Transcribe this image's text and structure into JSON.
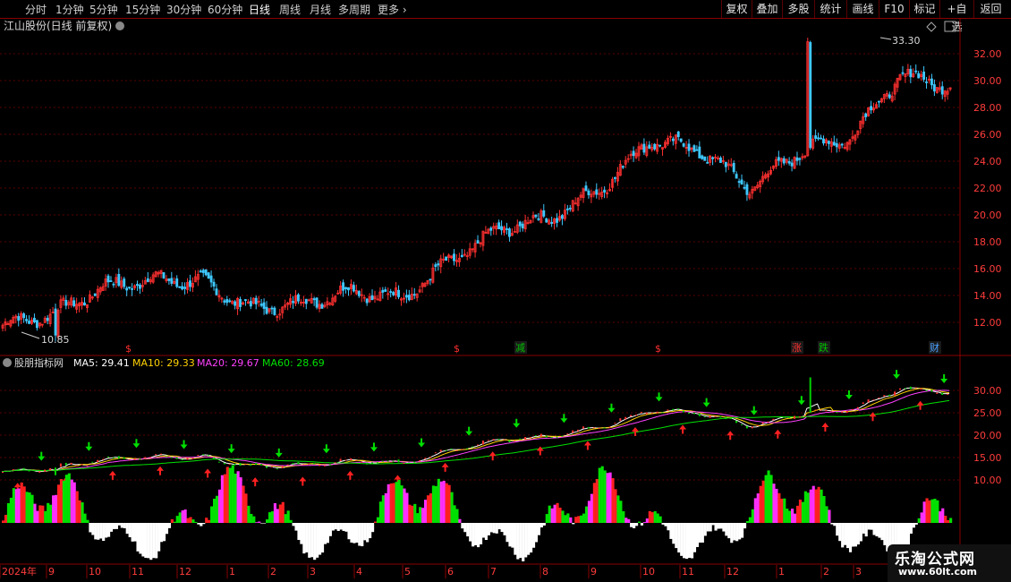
{
  "toolbar": {
    "periods": [
      "分时",
      "1分钟",
      "5分钟",
      "15分钟",
      "30分钟",
      "60分钟",
      "日线",
      "周线",
      "月线",
      "多周期",
      "更多"
    ],
    "active_period": "日线",
    "buttons": [
      "复权",
      "叠加",
      "多股",
      "统计",
      "画线",
      "F10",
      "标记",
      "+自选",
      "返回"
    ]
  },
  "main_panel": {
    "title": "江山股份(日线 前复权)",
    "high_marker": "33.30",
    "low_marker": "10.85",
    "price_axis": [
      "32.00",
      "30.00",
      "28.00",
      "26.00",
      "24.00",
      "22.00",
      "20.00",
      "18.00",
      "16.00",
      "14.00",
      "12.00"
    ],
    "event_marks": [
      {
        "text": "$",
        "color": "#ff3030"
      },
      {
        "text": "$",
        "color": "#ff3030"
      },
      {
        "text": "减",
        "color": "#00c000"
      },
      {
        "text": "$",
        "color": "#ff3030"
      },
      {
        "text": "涨",
        "color": "#ff3030"
      },
      {
        "text": "跌",
        "color": "#00c000"
      },
      {
        "text": "财",
        "color": "#4aa0ff"
      }
    ]
  },
  "indicator_panel": {
    "name": "股朋指标网",
    "ma5_label": "MA5: 29.41",
    "ma10_label": "MA10: 29.33",
    "ma20_label": "MA20: 29.67",
    "ma60_label": "MA60: 28.69",
    "colors": {
      "ma5": "#ffffff",
      "ma10": "#ffd200",
      "ma20": "#ff40ff",
      "ma60": "#00e000"
    },
    "price_axis": [
      "30.00",
      "25.00",
      "20.00",
      "15.00",
      "10.00"
    ]
  },
  "time_axis": [
    "2024年",
    "9",
    "10",
    "11",
    "12",
    "1",
    "2",
    "3",
    "4",
    "5",
    "6",
    "7",
    "8",
    "9",
    "10",
    "11",
    "12",
    "1",
    "2",
    "3"
  ],
  "watermark": {
    "line1": "乐淘公式网",
    "line2": "www.60lt.com"
  },
  "chart_data": {
    "type": "candlestick",
    "title": "江山股份(日线 前复权)",
    "x_range": [
      "2024-08",
      "2026-03"
    ],
    "ylim": [
      10.5,
      34
    ],
    "months": [
      "2024-08",
      "2024-09",
      "2024-10",
      "2024-11",
      "2024-12",
      "2025-01",
      "2025-02",
      "2025-03",
      "2025-04",
      "2025-05",
      "2025-06",
      "2025-07",
      "2025-08",
      "2025-09",
      "2025-10",
      "2025-11",
      "2025-12",
      "2026-01",
      "2026-02",
      "2026-03"
    ],
    "close_trend": [
      11.8,
      12.6,
      14.6,
      15.2,
      15.0,
      13.0,
      13.4,
      14.4,
      13.8,
      16.6,
      19.0,
      19.8,
      22.0,
      25.6,
      24.8,
      22.0,
      24.8,
      25.8,
      30.4,
      29.6
    ],
    "high": 33.3,
    "low": 10.85,
    "ma_last": {
      "MA5": 29.41,
      "MA10": 29.33,
      "MA20": 29.67,
      "MA60": 28.69
    }
  }
}
